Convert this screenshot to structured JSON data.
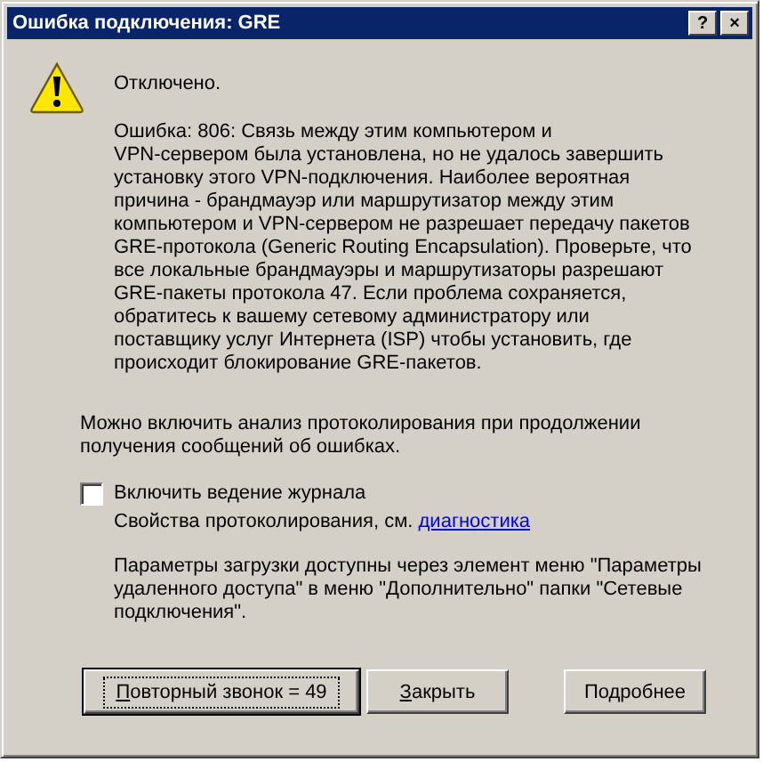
{
  "window": {
    "title": "Ошибка подключения: GRE",
    "title_buttons": [
      "?",
      "×"
    ]
  },
  "status": "Отключено.",
  "error_text": "Ошибка: 806: Связь между этим компьютером и\nVPN-сервером была установлена, но не удалось завершить\nустановку этого VPN-подключения. Наиболее вероятная\nпричина - брандмауэр или маршрутизатор между этим\nкомпьютером и VPN-сервером не разрешает передачу пакетов\nGRE-протокола (Generic Routing Encapsulation). Проверьте, что\nвсе локальные брандмауэры и маршрутизаторы разрешают\nGRE-пакеты протокола 47. Если проблема сохраняется,\nобратитесь к вашему сетевому администратору или\nпоставщику услуг Интернета (ISP) чтобы установить, где\nпроисходит блокирование GRE-пакетов.",
  "logging_hint": "Можно включить анализ протоколирования при продолжении\nполучения сообщений об ошибках.",
  "logging": {
    "label": "Включить ведение журнала",
    "checked": false,
    "note": "Свойства протоколирования, см.",
    "link": "диагностика"
  },
  "settings_note": "Параметры загрузки доступны через элемент меню \"Параметры\nудаленного доступа\" в меню \"Дополнительно\" папки \"Сетевые\nподключения\".",
  "buttons": [
    {
      "label": "Повторный звонок = 49",
      "default": true
    },
    {
      "label": "Закрыть",
      "default": false
    },
    {
      "label": "Подробнее",
      "default": false
    }
  ]
}
